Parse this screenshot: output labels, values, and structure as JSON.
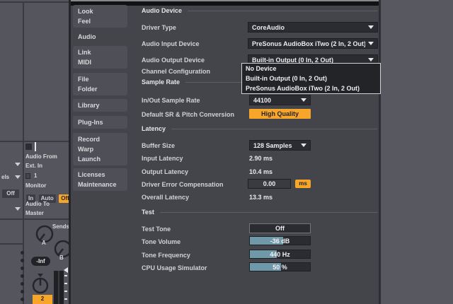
{
  "colors": {
    "accent_orange": "#f7a62a",
    "slider_fill": "#6f99a8",
    "dialog_bg": "#44454a"
  },
  "background": {
    "track": {
      "audio_from_label": "Audio From",
      "audio_from_value": "Ext. In",
      "input_channel": "1",
      "monitor_label": "Monitor",
      "monitor_in": "In",
      "monitor_auto": "Auto",
      "monitor_off": "Off",
      "audio_to_label": "Audio To",
      "audio_to_value": "Master",
      "left_truncated_text": "els",
      "left_monitor_off": "Off",
      "sends_label": "Sends",
      "send_a": "A",
      "send_b": "B",
      "volume_display": "-Inf",
      "track_number": "2"
    }
  },
  "preferences": {
    "sidebar": {
      "tabs": [
        {
          "lines": [
            "Look",
            "Feel"
          ]
        },
        {
          "lines": [
            "Audio"
          ]
        },
        {
          "lines": [
            "Link",
            "MIDI"
          ]
        },
        {
          "lines": [
            "File",
            "Folder"
          ]
        },
        {
          "lines": [
            "Library"
          ]
        },
        {
          "lines": [
            "Plug-Ins"
          ]
        },
        {
          "lines": [
            "Record",
            "Warp",
            "Launch"
          ]
        },
        {
          "lines": [
            "Licenses",
            "Maintenance"
          ]
        }
      ],
      "selected": "Audio"
    },
    "audio_device": {
      "title": "Audio Device",
      "driver_type_label": "Driver Type",
      "driver_type_value": "CoreAudio",
      "input_device_label": "Audio Input Device",
      "input_device_value": "PreSonus AudioBox iTwo (2 In, 2 Out)",
      "output_device_label": "Audio Output Device",
      "output_device_value": "Built-in Output (0 In, 2 Out)",
      "channel_config_label": "Channel Configuration",
      "output_device_menu": {
        "items": [
          "No Device",
          "Built-in Output (0 In, 2 Out)",
          "PreSonus AudioBox iTwo (2 In, 2 Out)"
        ]
      }
    },
    "sample_rate": {
      "title": "Sample Rate",
      "rate_label": "In/Out Sample Rate",
      "rate_value": "44100",
      "conversion_label": "Default SR & Pitch Conversion",
      "conversion_value": "High Quality"
    },
    "latency": {
      "title": "Latency",
      "buffer_label": "Buffer Size",
      "buffer_value": "128 Samples",
      "input_latency_label": "Input Latency",
      "input_latency_value": "2.90 ms",
      "output_latency_label": "Output Latency",
      "output_latency_value": "10.4 ms",
      "compensation_label": "Driver Error Compensation",
      "compensation_value": "0.00",
      "compensation_unit": "ms",
      "overall_label": "Overall Latency",
      "overall_value": "13.3 ms"
    },
    "test": {
      "title": "Test",
      "test_tone_label": "Test Tone",
      "test_tone_value": "Off",
      "tone_volume_label": "Tone Volume",
      "tone_volume_value": "-36 dB",
      "tone_volume_fill": 55,
      "tone_frequency_label": "Tone Frequency",
      "tone_frequency_value": "440 Hz",
      "tone_frequency_fill": 45,
      "cpu_label": "CPU Usage Simulator",
      "cpu_value": "50 %",
      "cpu_fill": 52
    }
  }
}
